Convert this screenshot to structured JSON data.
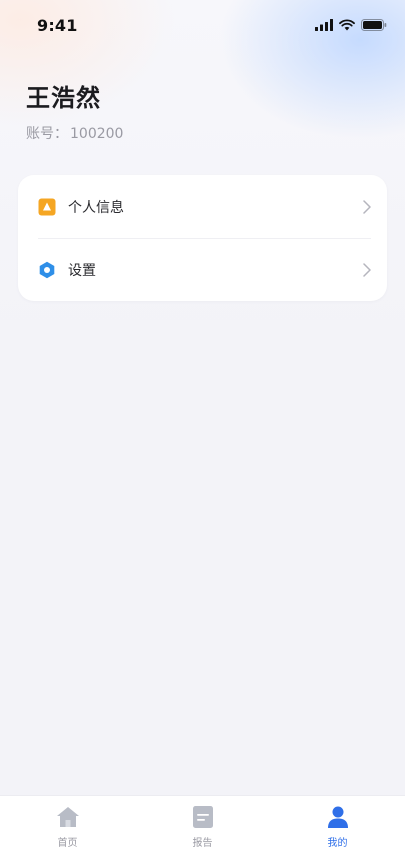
{
  "status_bar": {
    "time": "9:41",
    "icons": [
      "signal-icon",
      "wifi-icon",
      "battery-icon"
    ]
  },
  "profile": {
    "name": "王浩然",
    "account_label": "账号：",
    "account_value": "100200"
  },
  "menu": {
    "items": [
      {
        "label": "个人信息",
        "icon": "person-card-icon",
        "icon_color": "#f5a623"
      },
      {
        "label": "设置",
        "icon": "settings-hex-icon",
        "icon_color": "#2f8fe8"
      }
    ]
  },
  "tab_bar": {
    "items": [
      {
        "label": "首页",
        "icon": "home-icon",
        "active": false
      },
      {
        "label": "报告",
        "icon": "report-icon",
        "active": false
      },
      {
        "label": "我的",
        "icon": "profile-icon",
        "active": true
      }
    ],
    "active_color": "#2f6fe8",
    "inactive_color": "#b8bcc6"
  }
}
